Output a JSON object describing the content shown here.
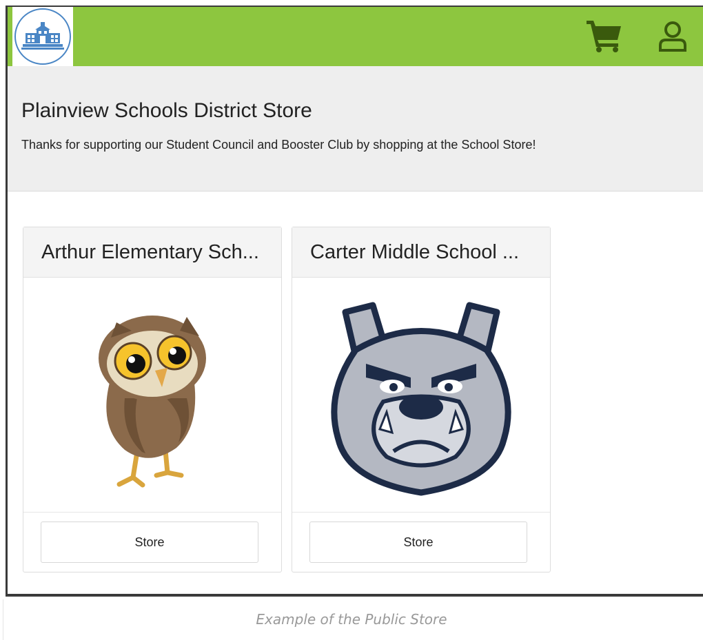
{
  "header": {
    "logo_icon": "school-building-icon",
    "cart_icon": "shopping-cart-icon",
    "account_icon": "user-account-icon",
    "brand_color": "#8dc63f",
    "icon_color": "#3a5a0d"
  },
  "hero": {
    "title": "Plainview Schools District Store",
    "subtitle": "Thanks for supporting our Student Council and Booster Club by shopping at the School Store!"
  },
  "stores": [
    {
      "name": "Arthur Elementary Sch...",
      "mascot": "owl-mascot",
      "button_label": "Store"
    },
    {
      "name": "Carter Middle School ...",
      "mascot": "bulldog-mascot",
      "button_label": "Store"
    }
  ],
  "caption": "Example of the Public Store"
}
